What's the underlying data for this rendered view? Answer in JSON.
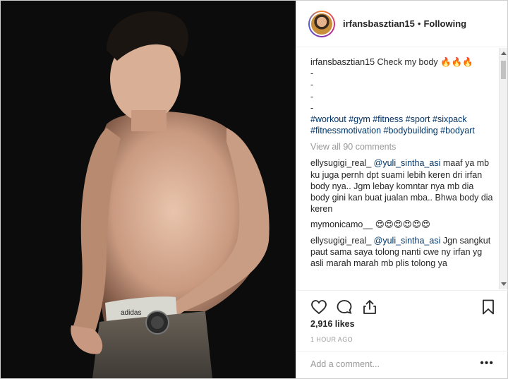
{
  "header": {
    "username": "irfansbasztian15",
    "separator": "•",
    "follow_status": "Following"
  },
  "caption": {
    "username": "irfansbasztian15",
    "text": "Check my body 🔥🔥🔥",
    "dashes": [
      "-",
      "-",
      "-",
      "-"
    ],
    "hashtags_line1": "#workout #gym #fitness #sport #sixpack",
    "hashtags_line2": "#fitnessmotivation #bodybuilding #bodyart"
  },
  "view_all": "View all 90 comments",
  "comments": [
    {
      "username": "ellysugigi_real_",
      "mention": "@yuli_sintha_asi",
      "text": "maaf ya mb ku juga pernh dpt suami lebih keren dri irfan body nya.. Jgm lebay komntar nya mb dia body gini kan buat jualan mba.. Bhwa body dia keren"
    },
    {
      "username": "mymonicamo__",
      "mention": "",
      "text": "😍😍😍😍😍😍"
    },
    {
      "username": "ellysugigi_real_",
      "mention": "@yuli_sintha_asi",
      "text": "Jgn sangkut paut sama saya tolong nanti cwe ny irfan yg asli marah marah mb plis tolong ya"
    }
  ],
  "likes": "2,916 likes",
  "timestamp": "1 HOUR AGO",
  "add_comment_placeholder": "Add a comment...",
  "more_options": "•••",
  "icons": {
    "like": "heart-icon",
    "comment": "comment-icon",
    "share": "share-icon",
    "save": "bookmark-icon"
  },
  "colors": {
    "hashtag": "#003569",
    "muted": "#999999",
    "text": "#262626"
  }
}
